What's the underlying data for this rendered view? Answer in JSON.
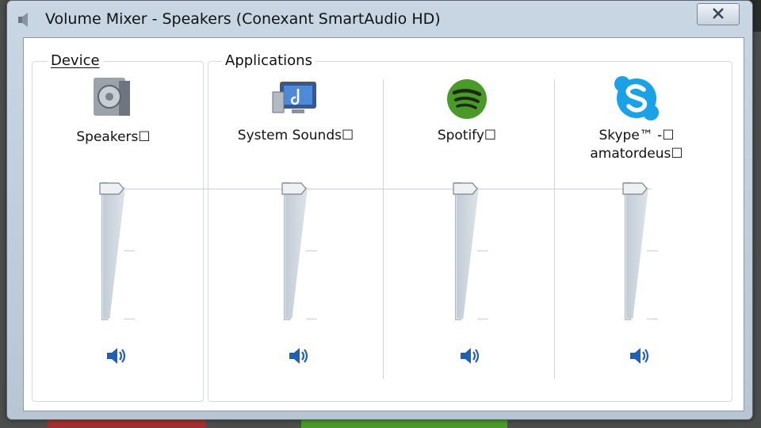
{
  "window": {
    "title": "Volume Mixer - Speakers (Conexant SmartAudio HD)"
  },
  "device": {
    "group_label": "Device",
    "channel": {
      "name": "Speakers☐",
      "icon": "speaker-icon",
      "volume_percent": 100
    }
  },
  "applications": {
    "group_label": "Applications",
    "channels": [
      {
        "name": "System Sounds☐",
        "icon": "system-sounds-icon",
        "volume_percent": 100
      },
      {
        "name": "Spotify☐",
        "icon": "spotify-icon",
        "volume_percent": 100
      },
      {
        "name": "Skype™ -☐",
        "name_line2": "amatordeus☐",
        "icon": "skype-icon",
        "volume_percent": 100
      }
    ]
  },
  "colors": {
    "spotify_green": "#4a9a2a",
    "skype_blue": "#1aa1e6",
    "mute_icon_blue": "#1f5fb4"
  }
}
